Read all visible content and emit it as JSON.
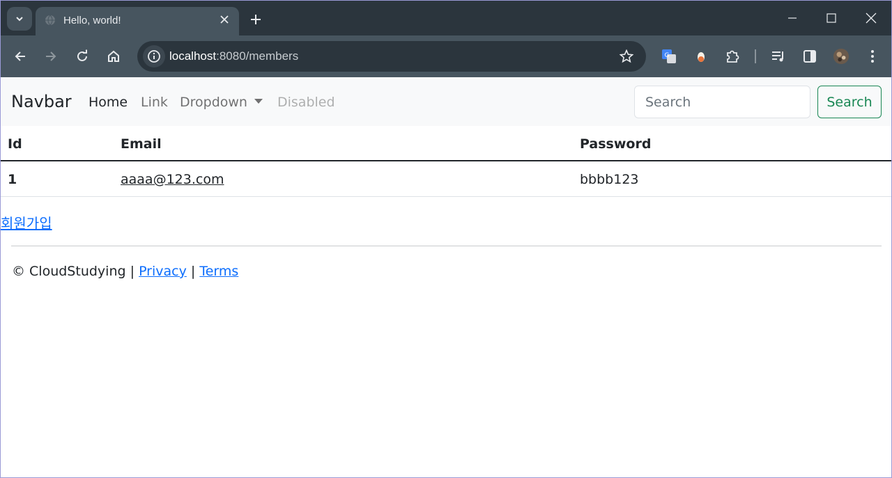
{
  "browser": {
    "tab_title": "Hello, world!",
    "url_host": "localhost",
    "url_path": ":8080/members"
  },
  "navbar": {
    "brand": "Navbar",
    "links": [
      "Home",
      "Link",
      "Dropdown",
      "Disabled"
    ],
    "search_placeholder": "Search",
    "search_button": "Search"
  },
  "table": {
    "headers": [
      "Id",
      "Email",
      "Password"
    ],
    "rows": [
      {
        "id": "1",
        "email": "aaaa@123.com",
        "password": "bbbb123"
      }
    ]
  },
  "signup_link": "회원가입",
  "footer": {
    "copyright": "© CloudStudying",
    "sep": "|",
    "privacy": "Privacy",
    "terms": "Terms"
  },
  "colors": {
    "link": "#0d6efd",
    "success": "#198754",
    "navbar_bg": "#f8f9fa",
    "chrome_dark": "#2b353d",
    "chrome_toolbar": "#47555f"
  }
}
